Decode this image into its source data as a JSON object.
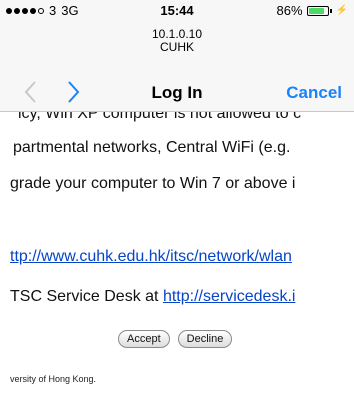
{
  "status_bar": {
    "carrier": "3",
    "network": "3G",
    "time": "15:44",
    "battery_percent": "86%",
    "battery_level": 0.86,
    "battery_color": "#4cd964"
  },
  "address": {
    "ip": "10.1.0.10",
    "name": "CUHK"
  },
  "nav": {
    "back_icon": "chevron-left-icon",
    "forward_icon": "chevron-right-icon",
    "title": "Log In",
    "cancel_label": "Cancel",
    "accent_color": "#1a82fb"
  },
  "content": {
    "clipped_line": "icy, Win XP computer is not allowed to c",
    "line1": "partmental networks, Central WiFi (e.g.",
    "line2": "grade your computer to Win 7 or above i",
    "link_url": "ttp://www.cuhk.edu.hk/itsc/network/wlan",
    "line4_text": "TSC Service Desk at ",
    "line4_link": "http://servicedesk.i",
    "accept_label": "Accept",
    "decline_label": "Decline",
    "footer": "versity of Hong Kong."
  }
}
